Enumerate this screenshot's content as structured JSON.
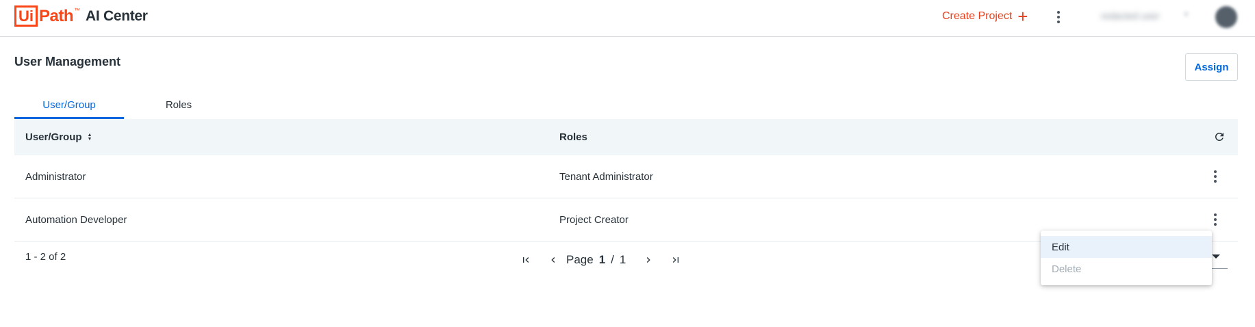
{
  "app": {
    "logo_ui": "Ui",
    "logo_path": "Path",
    "logo_tm": "™",
    "product": "AI Center"
  },
  "header": {
    "create_project_label": "Create Project",
    "create_project_icon": "+",
    "user_name": "redacted user",
    "user_chevron": "▾"
  },
  "page": {
    "title": "User Management",
    "assign_label": "Assign"
  },
  "tabs": [
    {
      "label": "User/Group",
      "active": true
    },
    {
      "label": "Roles",
      "active": false
    }
  ],
  "grid": {
    "columns": [
      {
        "label": "User/Group",
        "sortable": true
      },
      {
        "label": "Roles",
        "sortable": false
      }
    ],
    "rows": [
      {
        "user_group": "Administrator",
        "roles": "Tenant Administrator"
      },
      {
        "user_group": "Automation Developer",
        "roles": "Project Creator"
      }
    ]
  },
  "footer": {
    "range_text": "1 - 2 of 2",
    "page_label": "Page",
    "page_current": "1",
    "page_separator": "/",
    "page_total": "1"
  },
  "context_menu": {
    "items": [
      {
        "label": "Edit",
        "enabled": true
      },
      {
        "label": "Delete",
        "enabled": false
      }
    ]
  },
  "colors": {
    "brand": "#fa4616",
    "accent": "#0067df",
    "create_project": "#e8401c",
    "header_bg": "#f1f6f8"
  }
}
